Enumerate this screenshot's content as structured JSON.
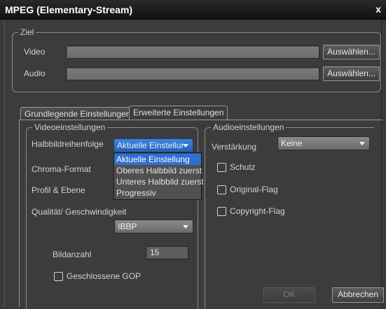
{
  "window": {
    "title": "MPEG (Elementary-Stream)",
    "close_glyph": "x"
  },
  "ziel": {
    "legend": "Ziel",
    "video_label": "Video",
    "video_value": "",
    "video_button": "Auswählen...",
    "audio_label": "Audio",
    "audio_value": "",
    "audio_button": "Auswählen..."
  },
  "tabs": [
    {
      "label": "Grundlegende Einstellungen",
      "active": false
    },
    {
      "label": "Erweiterte Einstellungen",
      "active": true
    }
  ],
  "video_settings": {
    "legend": "Videoeinstellungen",
    "field_order_label": "Halbbildreihenfolge",
    "field_order_value": "Aktuelle Einstellur",
    "field_order_options": [
      "Aktuelle Einstellung",
      "Oberes Halbbild zuerst",
      "Unteres Halbbild zuerst",
      "Progressiv"
    ],
    "field_order_selected_index": 0,
    "chroma_label": "Chroma-Format",
    "profile_label": "Profil & Ebene",
    "quality_label": "Qualität/ Geschwindigkeit",
    "gop_value": "IBBP",
    "frame_count_label": "Bildanzahl",
    "frame_count_value": "15",
    "closed_gop_label": "Geschlossene GOP"
  },
  "audio_settings": {
    "legend": "Audioeinstellungen",
    "gain_label": "Verstärkung",
    "gain_value": "Keine",
    "protect_label": "Schutz",
    "original_label": "Original-Flag",
    "copyright_label": "Copyright-Flag"
  },
  "footer": {
    "ok": "OK",
    "cancel": "Abbrechen"
  },
  "colors": {
    "accent": "#2f6fd0",
    "background": "#3c3c3c"
  }
}
